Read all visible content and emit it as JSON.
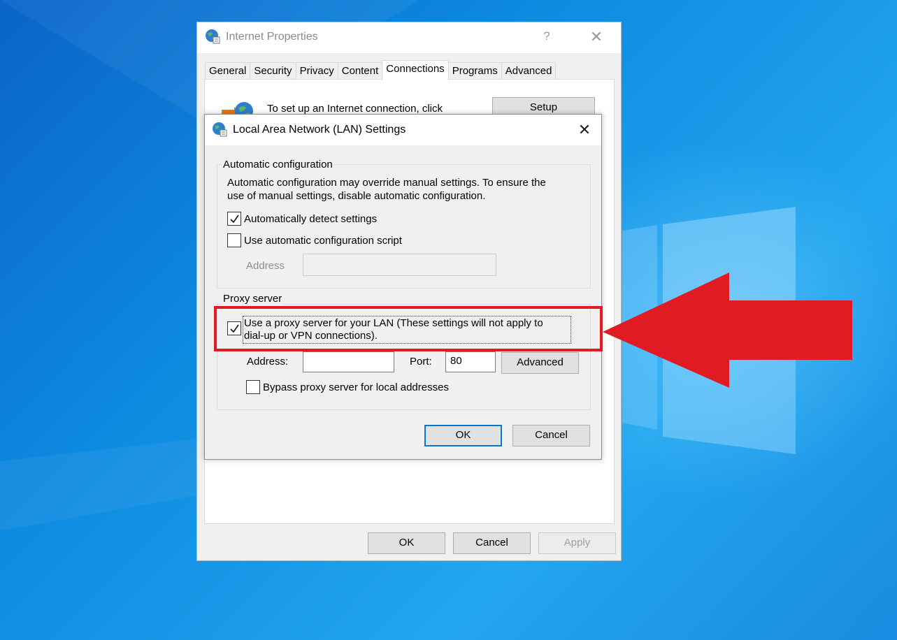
{
  "colors": {
    "desktop_blue": "#0d8be0",
    "accent": "#0078d7",
    "highlight_red": "#e11b23"
  },
  "internet_properties": {
    "title": "Internet Properties",
    "help": "?",
    "close": "✕",
    "tabs": [
      {
        "label": "General",
        "active": false
      },
      {
        "label": "Security",
        "active": false
      },
      {
        "label": "Privacy",
        "active": false
      },
      {
        "label": "Content",
        "active": false
      },
      {
        "label": "Connections",
        "active": true
      },
      {
        "label": "Programs",
        "active": false
      },
      {
        "label": "Advanced",
        "active": false
      }
    ],
    "setup_text": "To set up an Internet connection, click",
    "setup_button": "Setup",
    "ok": "OK",
    "cancel": "Cancel",
    "apply": "Apply"
  },
  "lan_dialog": {
    "title": "Local Area Network (LAN) Settings",
    "close": "✕",
    "auto_config": {
      "group_label": "Automatic configuration",
      "description_line1": "Automatic configuration may override manual settings.  To ensure the",
      "description_line2": "use of manual settings, disable automatic configuration.",
      "auto_detect_label": "Automatically detect settings",
      "auto_detect_checked": true,
      "use_script_label": "Use automatic configuration script",
      "use_script_checked": false,
      "address_label": "Address",
      "address_value": ""
    },
    "proxy": {
      "group_label": "Proxy server",
      "use_proxy_line1": "Use a proxy server for your LAN (These settings will not apply to",
      "use_proxy_line2": "dial-up or VPN connections).",
      "use_proxy_checked": true,
      "address_label": "Address:",
      "address_value": "",
      "port_label": "Port:",
      "port_value": "80",
      "advanced_button": "Advanced",
      "bypass_label": "Bypass proxy server for local addresses",
      "bypass_checked": false
    },
    "ok": "OK",
    "cancel": "Cancel"
  },
  "annotation": {
    "arrow_icon": "red-arrow-icon"
  }
}
